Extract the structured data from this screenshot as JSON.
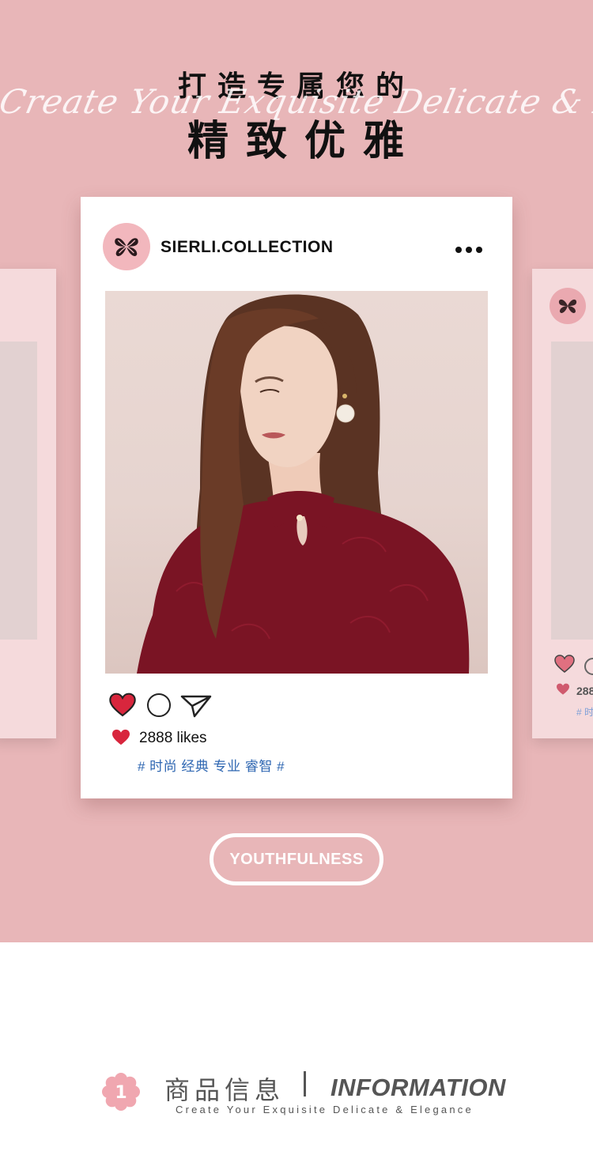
{
  "header": {
    "headline_line1": "打造专属您的",
    "script_line": "Create Your Exquisite Delicate & Elegance",
    "headline_line2": "精致优雅"
  },
  "post": {
    "account_name": "SIERLI.COLLECTION",
    "likes": "2888 likes",
    "tags": "# 时尚 经典 专业 睿智 #"
  },
  "side_card_right": {
    "likes_partial": "288",
    "tags_partial": "# 时"
  },
  "badge": {
    "label": "YOUTHFULNESS"
  },
  "info_section": {
    "number": "1",
    "title_cn": "商品信息",
    "title_en": "INFORMATION",
    "subtitle": "Create Your Exquisite Delicate & Elegance"
  },
  "colors": {
    "background_pink": "#e8b6b8",
    "card_white": "#ffffff",
    "like_red": "#d8263d",
    "tag_blue": "#2f67b2",
    "flower_pink": "#f0a7b0"
  },
  "icons": {
    "brand_logo": "butterfly-monogram-icon",
    "more": "ellipsis-icon",
    "like": "heart-icon",
    "comment": "comment-circle-icon",
    "share": "paper-plane-icon"
  }
}
